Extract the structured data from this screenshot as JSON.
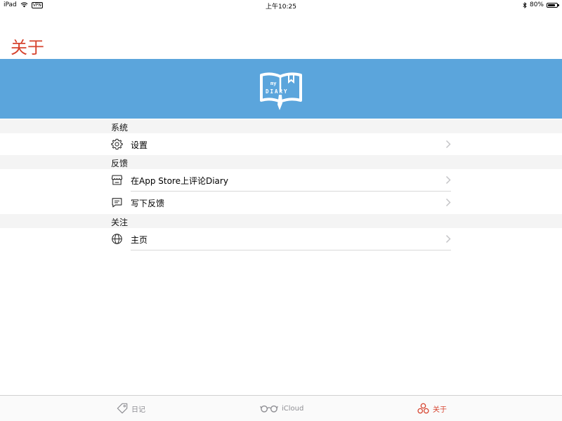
{
  "status_bar": {
    "device": "iPad",
    "vpn": "VPN",
    "time": "上午10:25",
    "battery": "80%",
    "battery_level": 0.8
  },
  "header": {
    "title": "关于"
  },
  "banner": {
    "color": "#5ba5dc",
    "logo_line1": "my",
    "logo_line2": "DIARY"
  },
  "sections": {
    "system": {
      "header": "系统",
      "settings": {
        "label": "设置",
        "icon": "gear-icon"
      }
    },
    "feedback": {
      "header": "反馈",
      "rate": {
        "label": "在App Store上评论Diary",
        "icon": "store-icon"
      },
      "write": {
        "label": "写下反馈",
        "icon": "message-icon"
      }
    },
    "follow": {
      "header": "关注",
      "homepage": {
        "label": "主页",
        "icon": "globe-icon"
      }
    }
  },
  "tabs": {
    "diary": {
      "label": "日记",
      "icon": "tag-icon"
    },
    "icloud": {
      "label": "iCloud",
      "icon": "glasses-icon"
    },
    "about": {
      "label": "关于",
      "icon": "circles-icon",
      "active": true
    }
  },
  "colors": {
    "accent": "#d6432e",
    "inactive": "#8e8e93"
  }
}
